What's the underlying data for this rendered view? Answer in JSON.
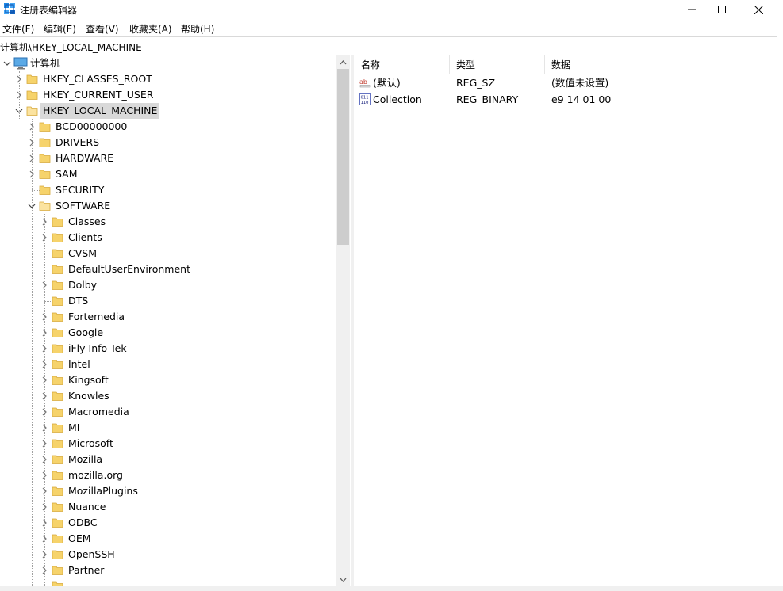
{
  "window": {
    "title": "注册表编辑器"
  },
  "menu": [
    "文件(F)",
    "编辑(E)",
    "查看(V)",
    "收藏夹(A)",
    "帮助(H)"
  ],
  "address": "计算机\\HKEY_LOCAL_MACHINE",
  "tree": {
    "root": "计算机",
    "hives": [
      "HKEY_CLASSES_ROOT",
      "HKEY_CURRENT_USER",
      "HKEY_LOCAL_MACHINE"
    ],
    "selected": "HKEY_LOCAL_MACHINE",
    "hklm_children": [
      "BCD00000000",
      "DRIVERS",
      "HARDWARE",
      "SAM",
      "SECURITY",
      "SOFTWARE"
    ],
    "software_children": [
      "Classes",
      "Clients",
      "CVSM",
      "DefaultUserEnvironment",
      "Dolby",
      "DTS",
      "Fortemedia",
      "Google",
      "iFly Info Tek",
      "Intel",
      "Kingsoft",
      "Knowles",
      "Macromedia",
      "MI",
      "Microsoft",
      "Mozilla",
      "mozilla.org",
      "MozillaPlugins",
      "Nuance",
      "ODBC",
      "OEM",
      "OpenSSH",
      "Partner"
    ]
  },
  "list": {
    "columns": [
      "名称",
      "类型",
      "数据"
    ],
    "rows": [
      {
        "name": "(默认)",
        "type": "REG_SZ",
        "data": "(数值未设置)",
        "icon": "string-value-icon"
      },
      {
        "name": "Collection",
        "type": "REG_BINARY",
        "data": "e9 14 01 00",
        "icon": "binary-value-icon"
      }
    ]
  },
  "colors": {
    "folder": "#f6d36b",
    "selection": "#d9d9d9",
    "scroll_thumb": "#cdcdcd"
  }
}
